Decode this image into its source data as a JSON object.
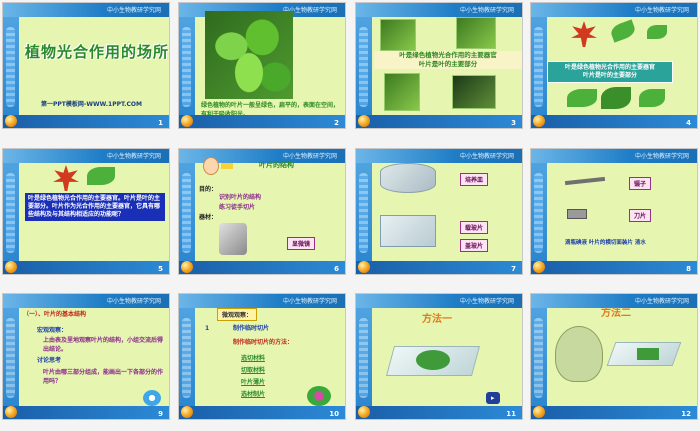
{
  "header_text": "中小生物教研学究网",
  "slides": [
    {
      "num": "1",
      "title": "植物光合作用的场所",
      "url": "第一PPT模板网-WWW.1PPT.COM"
    },
    {
      "num": "2",
      "caption": "绿色植物的叶片一般呈绿色，扁平的，表面在空间，有利于吸收阳光。"
    },
    {
      "num": "3",
      "caption": "叶是绿色植物光合作用的主要器官\n叶片是叶的主要部分"
    },
    {
      "num": "4",
      "caption": "叶是绿色植物光合作用的主要器官\n叶片是叶的主要部分"
    },
    {
      "num": "5",
      "caption": "叶是绿色植物光合作用的主要器官。叶片是叶的主要部分。叶片作为光合作用的主要器官，它具有哪些结构及与其结构相适应的功能呢？"
    },
    {
      "num": "6",
      "heading": "叶片的结构",
      "goal_label": "目的：",
      "goal_1": "识别叶片的结构",
      "goal_2": "练习徒手切片",
      "tools_label": "器材：",
      "tool_microscope": "显微镜"
    },
    {
      "num": "7",
      "label_1": "培养皿",
      "label_2": "载玻片",
      "label_3": "盖玻片"
    },
    {
      "num": "8",
      "label_1": "镊子",
      "label_2": "刀片",
      "caption": "滴瓶碘液 叶片的横切面装片 清水"
    },
    {
      "num": "9",
      "heading": "（一）、叶片的基本结构",
      "step_1_label": "宏观观察：",
      "step_1_text": "上由表及里地观察叶片的结构，小组交流后得出结论。",
      "step_2_label": "讨论思考",
      "step_2_text": "叶片由哪三部分组成，能画出一下各部分的作用吗？"
    },
    {
      "num": "10",
      "heading": "微观观察：",
      "item_num": "1",
      "item_text": "制作临时切片",
      "sub": "制作临时切片的方法：",
      "steps": [
        "选切材料",
        "切取材料",
        "叶片薄片",
        "选材制片"
      ]
    },
    {
      "num": "11",
      "heading": "方法一"
    },
    {
      "num": "12",
      "heading": "方法二"
    }
  ]
}
